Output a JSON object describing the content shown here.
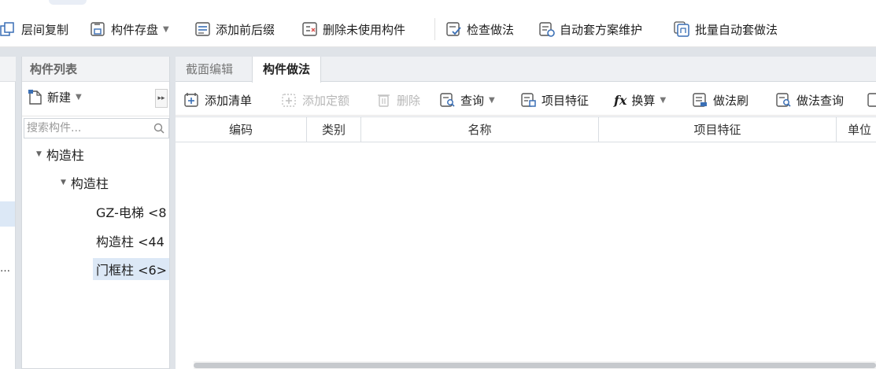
{
  "toolbar": {
    "items": [
      {
        "label": "层间复制",
        "icon": "copy-icon"
      },
      {
        "label": "构件存盘",
        "icon": "save-icon",
        "has_dropdown": true
      },
      {
        "label": "添加前后缀",
        "icon": "prefix-suffix-icon"
      },
      {
        "label": "删除未使用构件",
        "icon": "delete-unused-icon"
      },
      {
        "label": "检查做法",
        "icon": "check-method-icon"
      },
      {
        "label": "自动套方案维护",
        "icon": "auto-scheme-icon"
      },
      {
        "label": "批量自动套做法",
        "icon": "batch-auto-icon"
      }
    ]
  },
  "left_strip": {
    "ellipsis": "…"
  },
  "component_panel": {
    "title": "构件列表",
    "new_label": "新建",
    "expand_glyph": "▸▸",
    "search_placeholder": "搜索构件...",
    "tree": [
      {
        "label": "构造柱",
        "level": 0,
        "expanded": true
      },
      {
        "label": "构造柱",
        "level": 1,
        "expanded": true
      },
      {
        "label": "GZ-电梯 <8",
        "level": 2
      },
      {
        "label": "构造柱 <44",
        "level": 2
      },
      {
        "label": "门框柱 <6>",
        "level": 2,
        "selected": true
      }
    ]
  },
  "main": {
    "tabs": [
      {
        "label": "截面编辑",
        "active": false
      },
      {
        "label": "构件做法",
        "active": true
      }
    ],
    "toolbar": {
      "add_list": "添加清单",
      "add_quota": "添加定额",
      "delete": "删除",
      "query": "查询",
      "item_features": "项目特征",
      "calc": "换算",
      "method_brush": "做法刷",
      "method_query": "做法查询"
    },
    "columns": [
      "编码",
      "类别",
      "名称",
      "项目特征",
      "单位"
    ]
  },
  "colors": {
    "accent_blue": "#3a6fb5",
    "selection": "#dce8f6",
    "panel_gap": "#dfe3e8",
    "disabled_text": "#b7b7b7"
  }
}
